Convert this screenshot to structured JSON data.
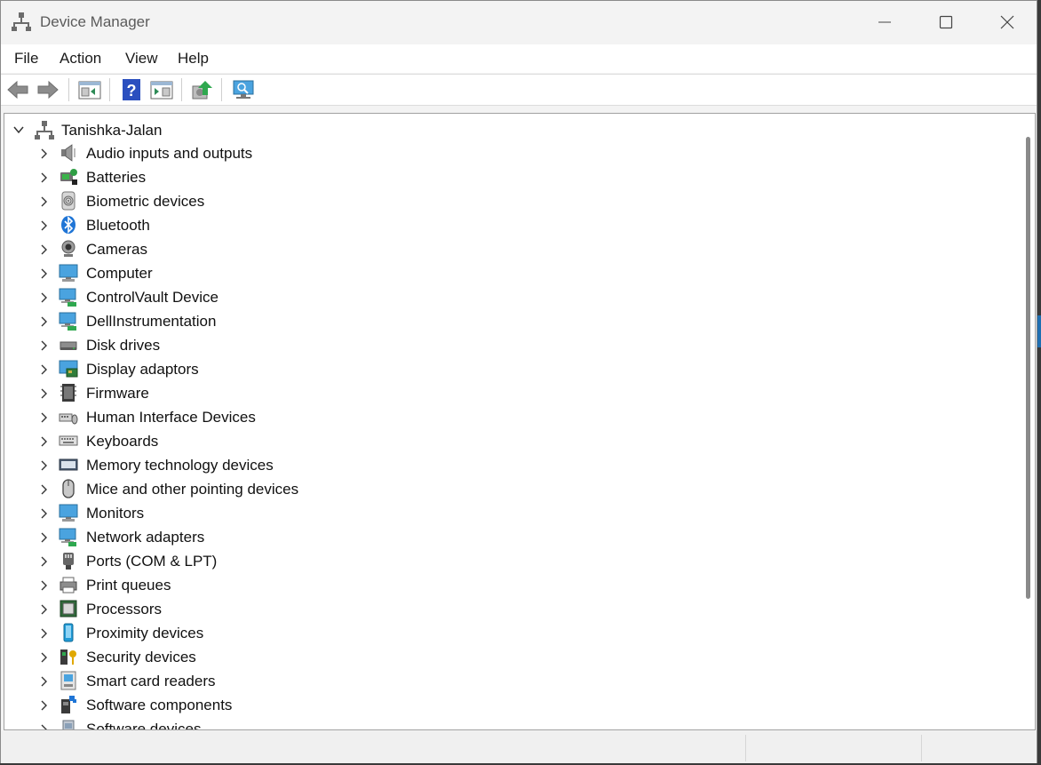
{
  "window": {
    "title": "Device Manager"
  },
  "menu": [
    "File",
    "Action",
    "View",
    "Help"
  ],
  "toolbar": {
    "buttons": [
      "back-arrow-icon",
      "forward-arrow-icon",
      "properties-icon",
      "help-icon",
      "details-view-icon",
      "update-driver-icon",
      "scan-hardware-icon"
    ]
  },
  "tree": {
    "root": "Tanishka-Jalan",
    "categories": [
      {
        "label": "Audio inputs and outputs",
        "icon": "speaker-icon"
      },
      {
        "label": "Batteries",
        "icon": "battery-icon"
      },
      {
        "label": "Biometric devices",
        "icon": "fingerprint-icon"
      },
      {
        "label": "Bluetooth",
        "icon": "bluetooth-icon"
      },
      {
        "label": "Cameras",
        "icon": "camera-icon"
      },
      {
        "label": "Computer",
        "icon": "computer-icon"
      },
      {
        "label": "ControlVault Device",
        "icon": "network-device-icon"
      },
      {
        "label": "DellInstrumentation",
        "icon": "network-device-icon"
      },
      {
        "label": "Disk drives",
        "icon": "disk-drive-icon"
      },
      {
        "label": "Display adaptors",
        "icon": "display-adapter-icon"
      },
      {
        "label": "Firmware",
        "icon": "firmware-icon"
      },
      {
        "label": "Human Interface Devices",
        "icon": "hid-icon"
      },
      {
        "label": "Keyboards",
        "icon": "keyboard-icon"
      },
      {
        "label": "Memory technology devices",
        "icon": "memory-icon"
      },
      {
        "label": "Mice and other pointing devices",
        "icon": "mouse-icon"
      },
      {
        "label": "Monitors",
        "icon": "monitor-icon"
      },
      {
        "label": "Network adapters",
        "icon": "network-adapter-icon"
      },
      {
        "label": "Ports (COM & LPT)",
        "icon": "port-icon"
      },
      {
        "label": "Print queues",
        "icon": "printer-icon"
      },
      {
        "label": "Processors",
        "icon": "processor-icon"
      },
      {
        "label": "Proximity devices",
        "icon": "proximity-icon"
      },
      {
        "label": "Security devices",
        "icon": "security-key-icon"
      },
      {
        "label": "Smart card readers",
        "icon": "smart-card-icon"
      },
      {
        "label": "Software components",
        "icon": "software-component-icon"
      },
      {
        "label": "Software devices",
        "icon": "software-device-icon"
      }
    ]
  }
}
